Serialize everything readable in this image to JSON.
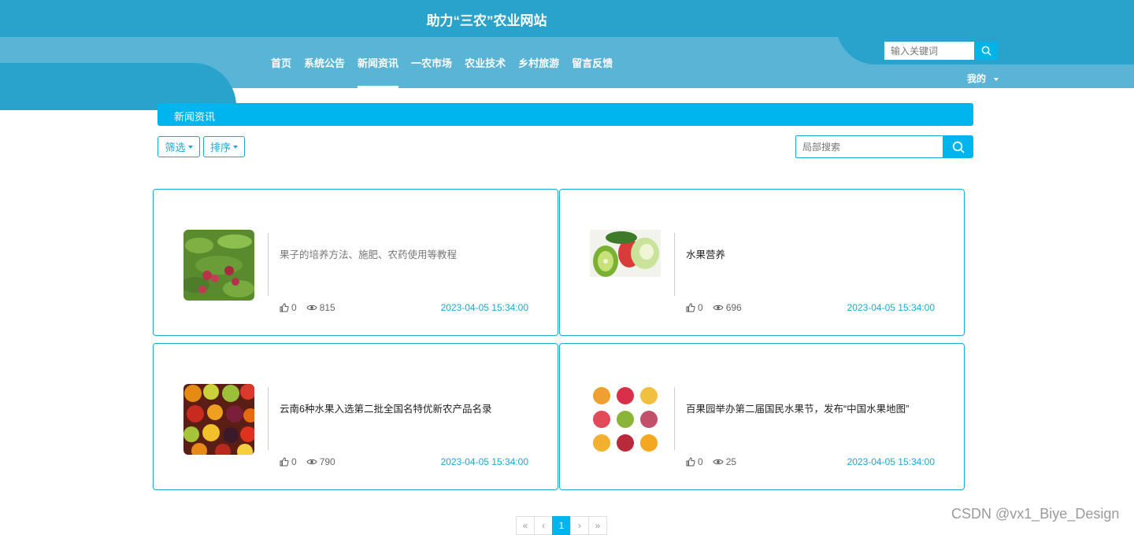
{
  "site": {
    "title": "助力“三农”农业网站"
  },
  "nav": {
    "items": [
      {
        "label": "首页"
      },
      {
        "label": "系统公告"
      },
      {
        "label": "新闻资讯"
      },
      {
        "label": "一农市场"
      },
      {
        "label": "农业技术"
      },
      {
        "label": "乡村旅游"
      },
      {
        "label": "留言反馈"
      }
    ],
    "active": "新闻资讯"
  },
  "header_search": {
    "placeholder": "输入关键词"
  },
  "user_menu": {
    "label": "我的"
  },
  "section": {
    "title": "新闻资讯"
  },
  "toolbar": {
    "filter_label": "筛选",
    "sort_label": "排序",
    "search_placeholder": "局部搜索"
  },
  "news": [
    {
      "title": "果子的培养方法、施肥、农药使用等教程",
      "likes": "0",
      "views": "815",
      "date": "2023-04-05 15:34:00",
      "image": "peach-tree-icon"
    },
    {
      "title": "水果营养",
      "likes": "0",
      "views": "696",
      "date": "2023-04-05 15:34:00",
      "image": "kiwi-fruit-icon"
    },
    {
      "title": "云南6种水果入选第二批全国名特优新农产品名录",
      "likes": "0",
      "views": "790",
      "date": "2023-04-05 15:34:00",
      "image": "mixed-fruit-icon"
    },
    {
      "title": "百果园举办第二届国民水果节，发布“中国水果地图”",
      "likes": "0",
      "views": "25",
      "date": "2023-04-05 15:34:00",
      "image": "fruit-grid-icon"
    }
  ],
  "pagination": {
    "first": "«",
    "prev": "‹",
    "current": "1",
    "next": "›",
    "last": "»"
  },
  "watermark": "CSDN @vx1_Biye_Design",
  "colors": {
    "header": "#29a3cc",
    "nav": "#5ab4d6",
    "accent": "#00b4ee"
  }
}
